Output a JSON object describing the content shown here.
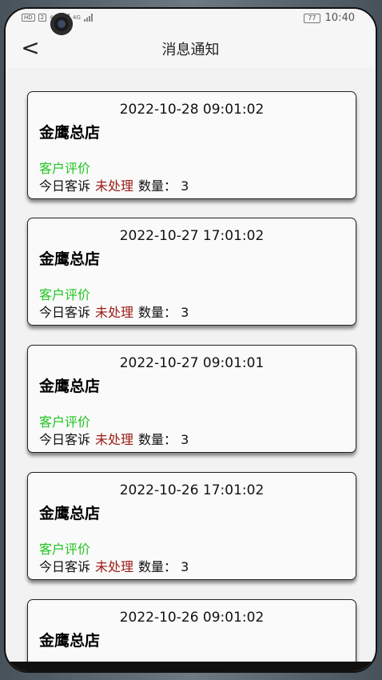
{
  "status_bar": {
    "left_chips": [
      "HD",
      "2"
    ],
    "signal_labels": [
      "4G",
      "4G"
    ],
    "battery": "77",
    "time": "10:40"
  },
  "header": {
    "back_label": "<",
    "title": "消息通知"
  },
  "colors": {
    "type_green": "#1ec51e",
    "status_red": "#9b1b14"
  },
  "notifications": [
    {
      "time": "2022-10-28 09:01:02",
      "store": "金鹰总店",
      "type": "客户评价",
      "prefix": "今日客诉",
      "status": "未处理",
      "count_label": "数量：",
      "count": "3"
    },
    {
      "time": "2022-10-27 17:01:02",
      "store": "金鹰总店",
      "type": "客户评价",
      "prefix": "今日客诉",
      "status": "未处理",
      "count_label": "数量：",
      "count": "3"
    },
    {
      "time": "2022-10-27 09:01:01",
      "store": "金鹰总店",
      "type": "客户评价",
      "prefix": "今日客诉",
      "status": "未处理",
      "count_label": "数量：",
      "count": "3"
    },
    {
      "time": "2022-10-26 17:01:02",
      "store": "金鹰总店",
      "type": "客户评价",
      "prefix": "今日客诉",
      "status": "未处理",
      "count_label": "数量：",
      "count": "3"
    },
    {
      "time": "2022-10-26 09:01:02",
      "store": "金鹰总店"
    }
  ]
}
